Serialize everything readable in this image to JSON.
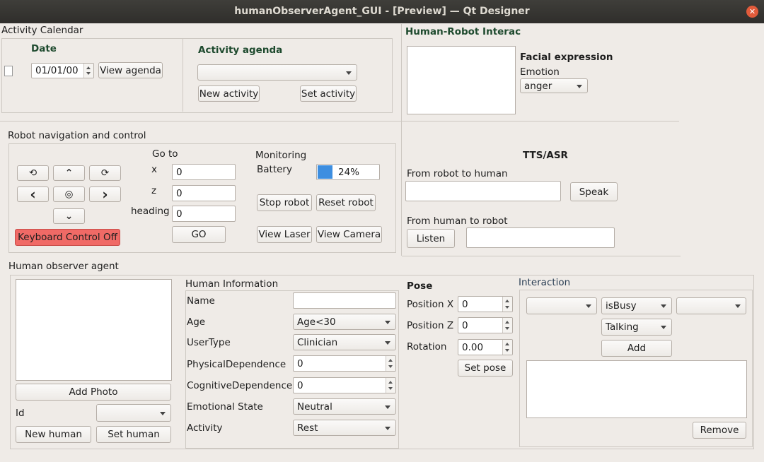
{
  "window": {
    "title": "humanObserverAgent_GUI - [Preview] — Qt Designer",
    "close": "✕"
  },
  "calendar": {
    "group_title": "Activity Calendar",
    "date_label": "Date",
    "date_value": "01/01/00",
    "view_agenda": "View agenda",
    "agenda_label": "Activity agenda",
    "agenda_selected": "",
    "new_activity": "New activity",
    "set_activity": "Set activity"
  },
  "hri": {
    "title": "Human-Robot Interac",
    "facial_expression": "Facial expression",
    "emotion_label": "Emotion",
    "emotion_value": "anger"
  },
  "navigation": {
    "title": "Robot navigation and control",
    "icons": {
      "rotate_left": "⟲",
      "up": "⌃",
      "rotate_right": "⟳",
      "left": "‹",
      "center": "◎",
      "right": "›",
      "down": "⌄"
    },
    "keyboard_control": "Keyboard Control Off",
    "goto_label": "Go to",
    "x_label": "x",
    "x_value": "0",
    "z_label": "z",
    "z_value": "0",
    "heading_label": "heading",
    "heading_value": "0",
    "go": "GO",
    "monitoring": "Monitoring",
    "battery_label": "Battery",
    "battery_text": "24%",
    "battery_level": 0.24,
    "stop_robot": "Stop robot",
    "reset_robot": "Reset robot",
    "view_laser": "View Laser",
    "view_camera": "View Camera"
  },
  "tts": {
    "title": "TTS/ASR",
    "robot_to_human": "From robot to human",
    "speak": "Speak",
    "human_to_robot": "From human to robot",
    "listen": "Listen",
    "speak_text": "",
    "listen_text": ""
  },
  "observer": {
    "title": "Human observer agent",
    "add_photo": "Add Photo",
    "id_label": "Id",
    "id_value": "",
    "new_human": "New human",
    "set_human": "Set human"
  },
  "human_info": {
    "title": "Human Information",
    "name_label": "Name",
    "name_value": "",
    "age_label": "Age",
    "age_value": "Age<30",
    "usertype_label": "UserType",
    "usertype_value": "Clinician",
    "physical_label": "PhysicalDependence",
    "physical_value": "0",
    "cognitive_label": "CognitiveDependence",
    "cognitive_value": "0",
    "emotional_label": "Emotional State",
    "emotional_value": "Neutral",
    "activity_label": "Activity",
    "activity_value": "Rest"
  },
  "pose": {
    "title": "Pose",
    "pos_x_label": "Position X",
    "pos_x_value": "0",
    "pos_z_label": "Position Z",
    "pos_z_value": "0",
    "rotation_label": "Rotation",
    "rotation_value": "0.00",
    "set_pose": "Set pose"
  },
  "interaction": {
    "title": "Interaction",
    "subject": "",
    "predicate": "isBusy",
    "object": "",
    "state": "Talking",
    "add": "Add",
    "remove": "Remove"
  },
  "colors": {
    "accent_green": "#1e4a2e",
    "battery_blue": "#3d8ee0",
    "keyboard_red": "#f06a66"
  }
}
